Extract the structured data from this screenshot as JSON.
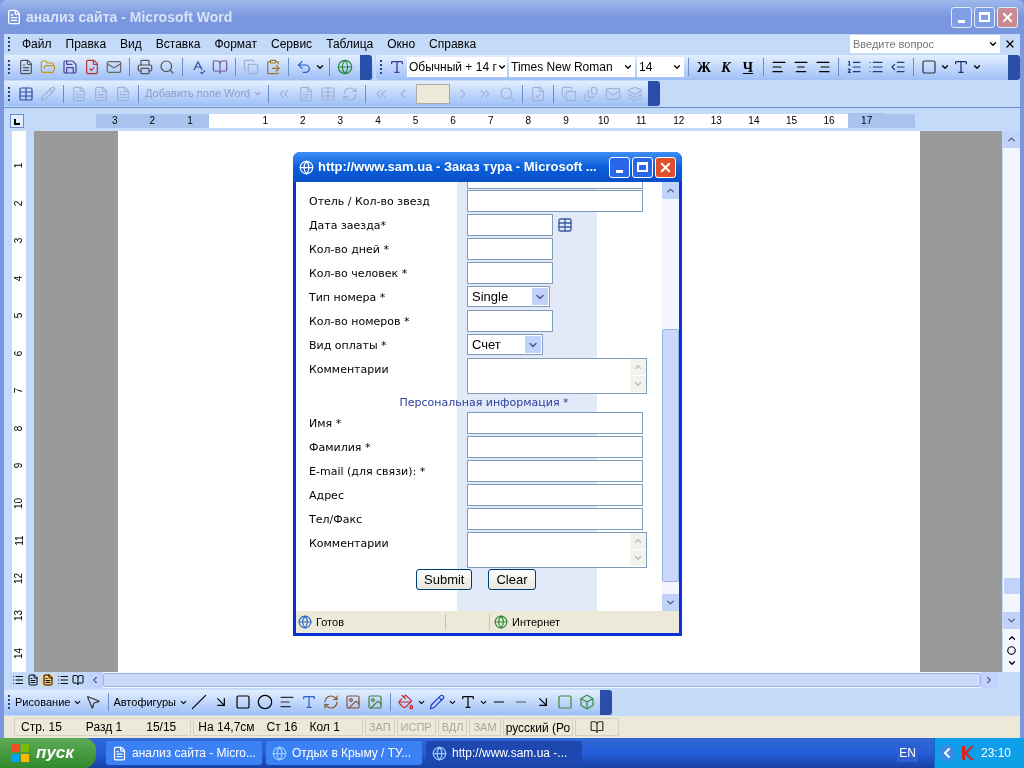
{
  "window": {
    "title": "анализ сайта - Microsoft Word"
  },
  "menu": [
    "Файл",
    "Правка",
    "Вид",
    "Вставка",
    "Формат",
    "Сервис",
    "Таблица",
    "Окно",
    "Справка"
  ],
  "help_box": {
    "placeholder": "Введите вопрос"
  },
  "formatting": {
    "style": "Обычный + 14 г",
    "font": "Times New Roman",
    "size": "14",
    "bold": "Ж",
    "italic": "К",
    "underline": "Ч"
  },
  "mail_merge": {
    "insert_field": "Добавить поле Word"
  },
  "ruler": {
    "left_labels": [
      "3",
      "2",
      "1"
    ],
    "labels": [
      "1",
      "2",
      "3",
      "4",
      "5",
      "6",
      "7",
      "8",
      "9",
      "10",
      "11",
      "12",
      "13",
      "14",
      "15",
      "16",
      "17"
    ]
  },
  "vertical_ruler": {
    "labels": [
      "1",
      "2",
      "3",
      "4",
      "5",
      "6",
      "7",
      "8",
      "9",
      "10",
      "11",
      "12",
      "13",
      "14"
    ]
  },
  "popup": {
    "title": "http://www.sam.ua - Заказ тура - Microsoft ...",
    "fields": [
      {
        "label": "Отель / Кол-во звезд",
        "kind": "wide"
      },
      {
        "label": "Дата заезда*",
        "kind": "date"
      },
      {
        "label": "Кол-во дней *",
        "kind": "short"
      },
      {
        "label": "Кол-во человек *",
        "kind": "short"
      },
      {
        "label": "Тип номера *",
        "kind": "select",
        "value": "Single"
      },
      {
        "label": "Кол-во номеров *",
        "kind": "short"
      },
      {
        "label": "Вид оплаты *",
        "kind": "select",
        "value": "Счет"
      },
      {
        "label": "Комментарии",
        "kind": "textarea"
      }
    ],
    "section": "Персональная информация *",
    "personal_fields": [
      {
        "label": "Имя *",
        "kind": "wide"
      },
      {
        "label": "Фамилия *",
        "kind": "wide"
      },
      {
        "label": "E-mail (для связи): *",
        "kind": "wide"
      },
      {
        "label": "Адрес",
        "kind": "wide"
      },
      {
        "label": "Тел/Факс",
        "kind": "wide"
      },
      {
        "label": "Комментарии",
        "kind": "textarea"
      }
    ],
    "buttons": [
      "Submit",
      "Clear"
    ],
    "status": "Готов",
    "zone": "Интернет"
  },
  "drawing_bar": {
    "draw": "Рисование",
    "autoshapes": "Автофигуры"
  },
  "status_bar": {
    "items": [
      "Стр. 15",
      "Разд 1",
      "15/15"
    ],
    "position": [
      "На 14,7см",
      "Ст 16",
      "Кол 1"
    ],
    "modes": [
      {
        "label": "ЗАП",
        "disabled": true
      },
      {
        "label": "ИСПР",
        "disabled": true
      },
      {
        "label": "ВДЛ",
        "disabled": true
      },
      {
        "label": "ЗАМ",
        "disabled": true
      }
    ],
    "language": "русский (Ро"
  },
  "taskbar": {
    "start": "пуск",
    "tasks": [
      {
        "label": "анализ сайта - Micro...",
        "selected": false,
        "kind": "word"
      },
      {
        "label": "Отдых в Крыму / ТУ...",
        "selected": false,
        "kind": "ie"
      },
      {
        "label": "http://www.sam.ua -...",
        "selected": true,
        "kind": "ie"
      }
    ],
    "lang": "EN",
    "clock": "23:10"
  }
}
